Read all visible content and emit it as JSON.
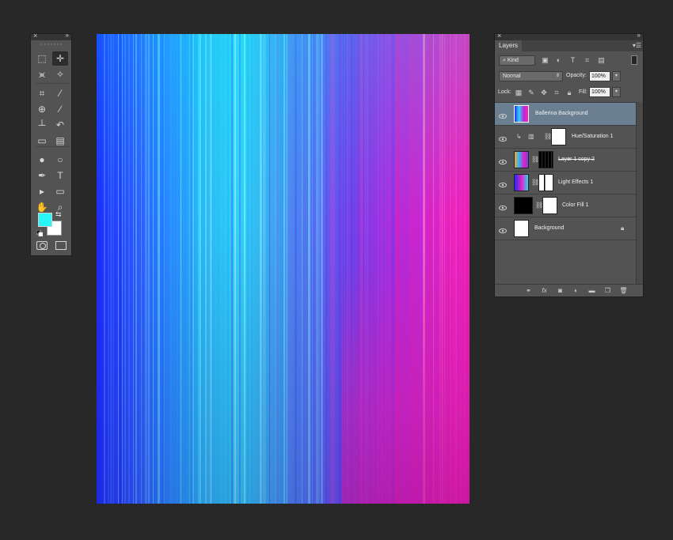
{
  "toolbox": {
    "collapse_label": "»",
    "close_label": "×",
    "tools": [
      {
        "name": "marquee-tool-icon",
        "glyph": "⬚"
      },
      {
        "name": "move-tool-icon",
        "glyph": "✛"
      },
      {
        "name": "lasso-tool-icon",
        "glyph": "⪤"
      },
      {
        "name": "magic-wand-tool-icon",
        "glyph": "✧"
      },
      {
        "name": "crop-tool-icon",
        "glyph": "⌗"
      },
      {
        "name": "eyedropper-tool-icon",
        "glyph": "⁄"
      },
      {
        "name": "healing-brush-tool-icon",
        "glyph": "⊕"
      },
      {
        "name": "brush-tool-icon",
        "glyph": "∕"
      },
      {
        "name": "clone-stamp-tool-icon",
        "glyph": "┴"
      },
      {
        "name": "history-brush-tool-icon",
        "glyph": "↶"
      },
      {
        "name": "eraser-tool-icon",
        "glyph": "▭"
      },
      {
        "name": "gradient-tool-icon",
        "glyph": "▤"
      },
      {
        "name": "blur-tool-icon",
        "glyph": "●"
      },
      {
        "name": "dodge-tool-icon",
        "glyph": "○"
      },
      {
        "name": "pen-tool-icon",
        "glyph": "✒"
      },
      {
        "name": "type-tool-icon",
        "glyph": "T"
      },
      {
        "name": "path-selection-tool-icon",
        "glyph": "▸"
      },
      {
        "name": "shape-tool-icon",
        "glyph": "▭"
      },
      {
        "name": "hand-tool-icon",
        "glyph": "✋"
      },
      {
        "name": "zoom-tool-icon",
        "glyph": "⌕"
      }
    ],
    "foreground_color": "#29f7f7",
    "background_color": "#ffffff"
  },
  "canvas": {
    "description_colors": [
      "#1d2cff",
      "#33d2f5",
      "#7a3ce6",
      "#ff1fb6"
    ]
  },
  "layers_panel": {
    "tab_label": "Layers",
    "filter_kind": "Kind",
    "blend_mode": "Normal",
    "opacity_label": "Opacity:",
    "opacity_value": "100%",
    "lock_label": "Lock:",
    "fill_label": "Fill:",
    "fill_value": "100%",
    "layers": [
      {
        "name": "Ballerina Background",
        "selected": true
      },
      {
        "name": "Hue/Saturation 1",
        "selected": false
      },
      {
        "name": "Layer 1 copy 2",
        "selected": false
      },
      {
        "name": "Light Effects 1",
        "selected": false
      },
      {
        "name": "Color Fill 1",
        "selected": false
      },
      {
        "name": "Background",
        "selected": false
      }
    ],
    "bottom_icons": [
      "link-layers-icon",
      "fx-icon",
      "add-mask-icon",
      "adjustment-layer-icon",
      "new-group-icon",
      "new-layer-icon",
      "delete-layer-icon"
    ],
    "fx_label": "fx"
  }
}
